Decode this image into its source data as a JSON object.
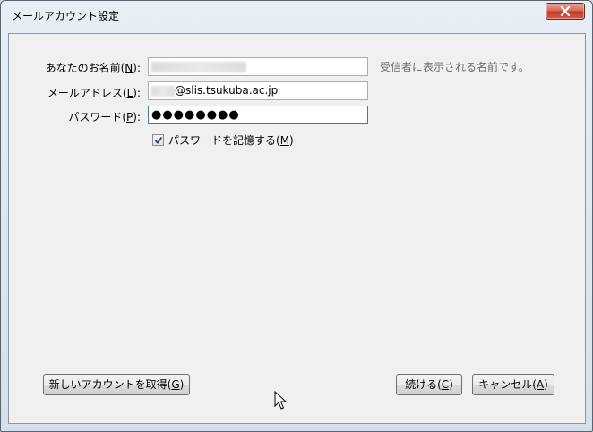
{
  "window": {
    "title": "メールアカウント設定"
  },
  "form": {
    "name_label": "あなたのお名前(N):",
    "name_label_pre": "あなたのお名前(",
    "name_label_key": "N",
    "name_label_post": "):",
    "name_hint": "受信者に表示される名前です。",
    "email_label_pre": "メールアドレス(",
    "email_label_key": "L",
    "email_label_post": "):",
    "email_value_domain": "@slis.tsukuba.ac.jp",
    "password_label_pre": "パスワード(",
    "password_label_key": "P",
    "password_label_post": "):",
    "password_value": "●●●●●●●●",
    "remember_label_pre": "パスワードを記憶する(",
    "remember_label_key": "M",
    "remember_label_post": ")",
    "remember_checked": true
  },
  "buttons": {
    "new_account_pre": "新しいアカウントを取得(",
    "new_account_key": "G",
    "new_account_post": ")",
    "continue_pre": "続ける(",
    "continue_key": "C",
    "continue_post": ")",
    "cancel_pre": "キャンセル(",
    "cancel_key": "A",
    "cancel_post": ")"
  },
  "icons": {
    "close": "close-icon",
    "checkmark": "checkmark-icon",
    "cursor": "mouse-cursor-icon"
  }
}
